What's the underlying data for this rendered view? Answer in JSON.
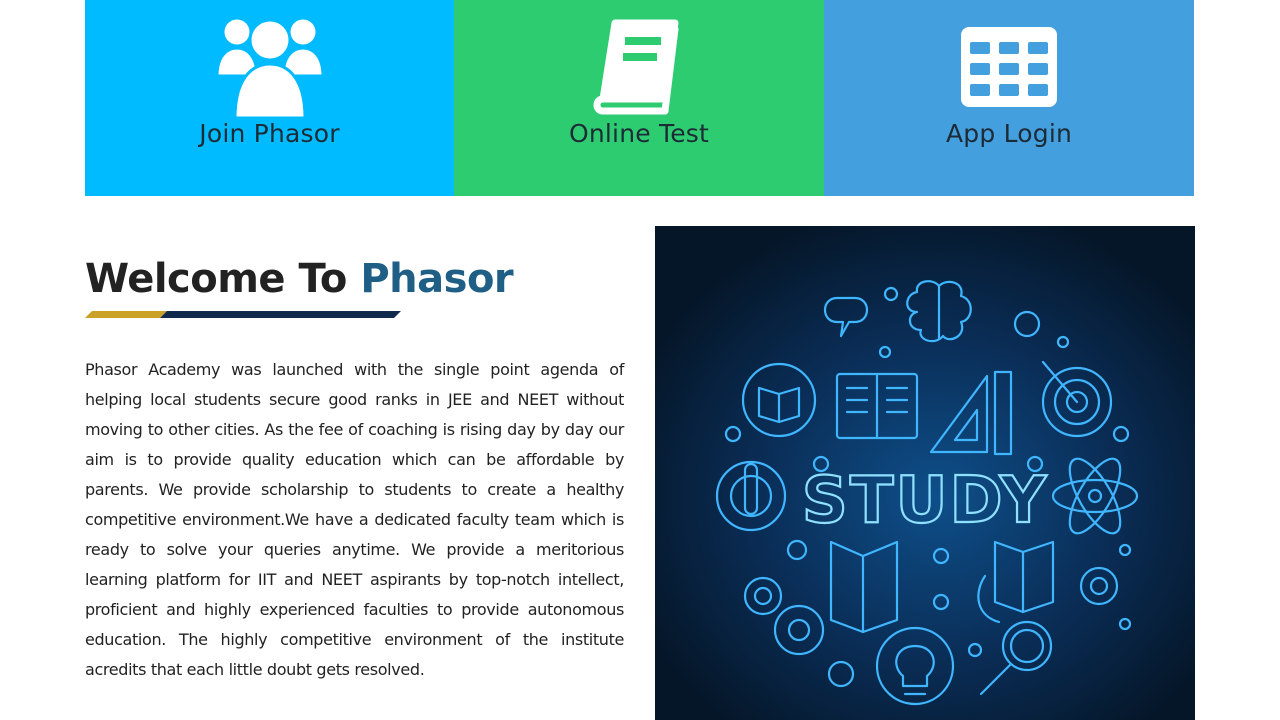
{
  "tiles": [
    {
      "label": "Join Phasor",
      "icon": "users-icon",
      "bg": "#00bbff"
    },
    {
      "label": "Online Test",
      "icon": "book-icon",
      "bg": "#2ecc71"
    },
    {
      "label": "App Login",
      "icon": "grid-icon",
      "bg": "#449fde"
    }
  ],
  "welcome": {
    "prefix": "Welcome To",
    "brand": "Phasor",
    "brand_color": "#1f5f86",
    "underline_colors": [
      "#c9a227",
      "#0f2a4a"
    ]
  },
  "about": {
    "text": "Phasor Academy was launched with the single point agenda of helping local students secure good ranks in JEE and NEET without moving to other cities. As the fee of coaching is rising day by day our aim is to provide quality education which can be affordable by parents. We provide scholarship to students to create a healthy competitive environment.We have a dedicated faculty team which is ready to solve your queries anytime. We provide a meritorious learning platform for IIT and NEET aspirants by top-notch intellect, proficient and highly experienced faculties to provide autonomous education. The highly competitive environment of the institute acredits that each little doubt gets resolved."
  },
  "study_image": {
    "caption": "STUDY",
    "background": "#061a33",
    "glow": "#3fb6ff"
  }
}
